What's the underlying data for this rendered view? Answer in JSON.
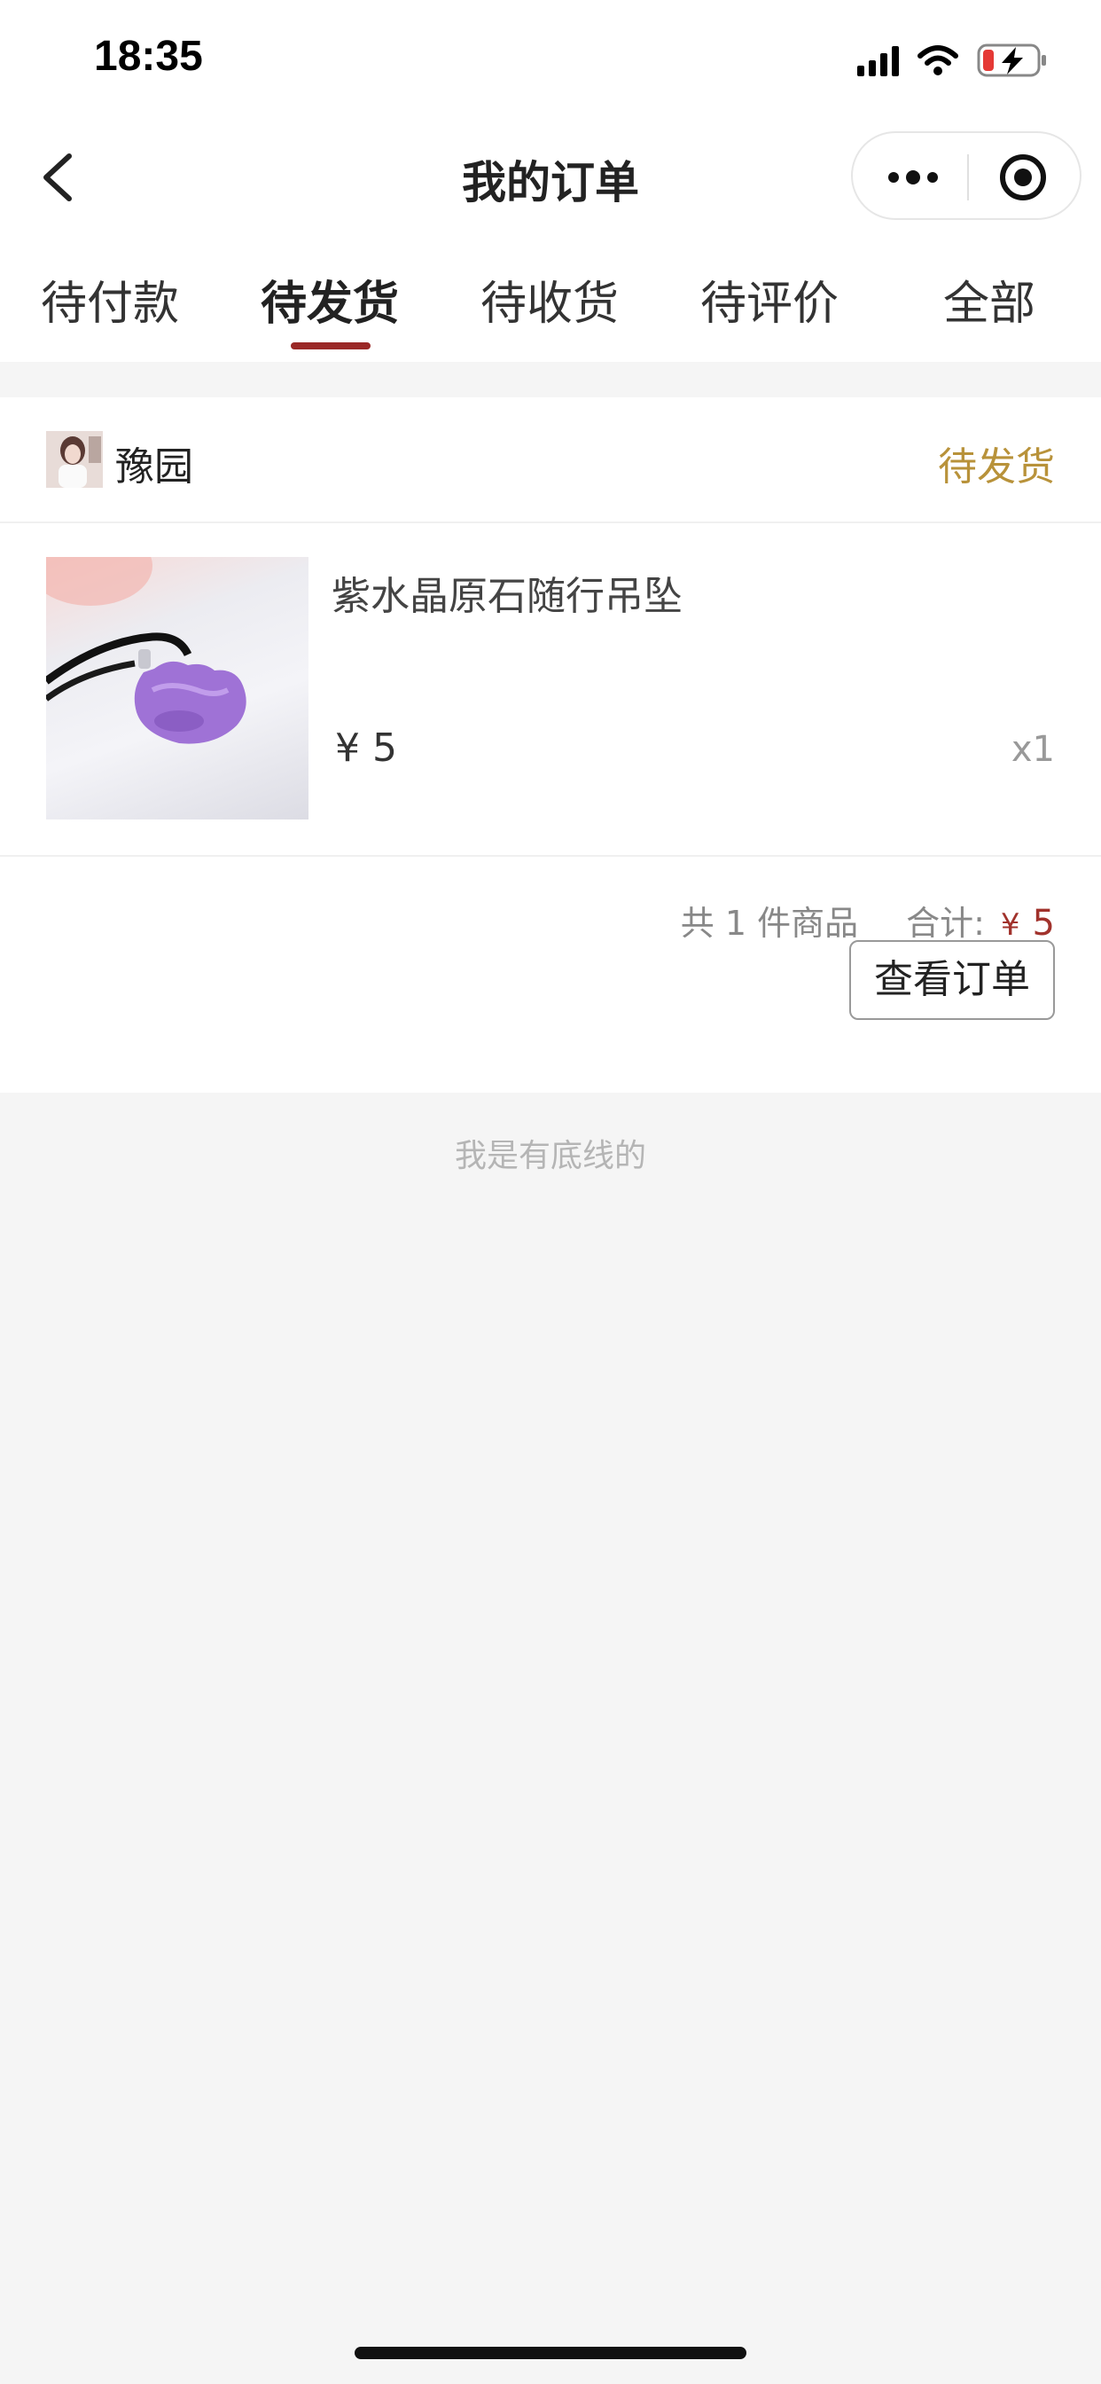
{
  "status_bar": {
    "time": "18:35"
  },
  "nav": {
    "title": "我的订单"
  },
  "tabs": [
    {
      "label": "待付款",
      "active": false
    },
    {
      "label": "待发货",
      "active": true
    },
    {
      "label": "待收货",
      "active": false
    },
    {
      "label": "待评价",
      "active": false
    },
    {
      "label": "全部",
      "active": false
    }
  ],
  "order": {
    "shop_name": "豫园",
    "status": "待发货",
    "product": {
      "name": "紫水晶原石随行吊坠",
      "price": "¥ 5",
      "quantity": "x1"
    },
    "summary": {
      "count_text": "共 1 件商品",
      "total_label": "合计:",
      "currency": "¥",
      "total": "5"
    },
    "view_button": "查看订单"
  },
  "footer_note": "我是有底线的",
  "colors": {
    "accent": "#9a2826",
    "status_gold": "#b8923a",
    "price_red": "#a1322c",
    "background": "#f5f5f5"
  }
}
